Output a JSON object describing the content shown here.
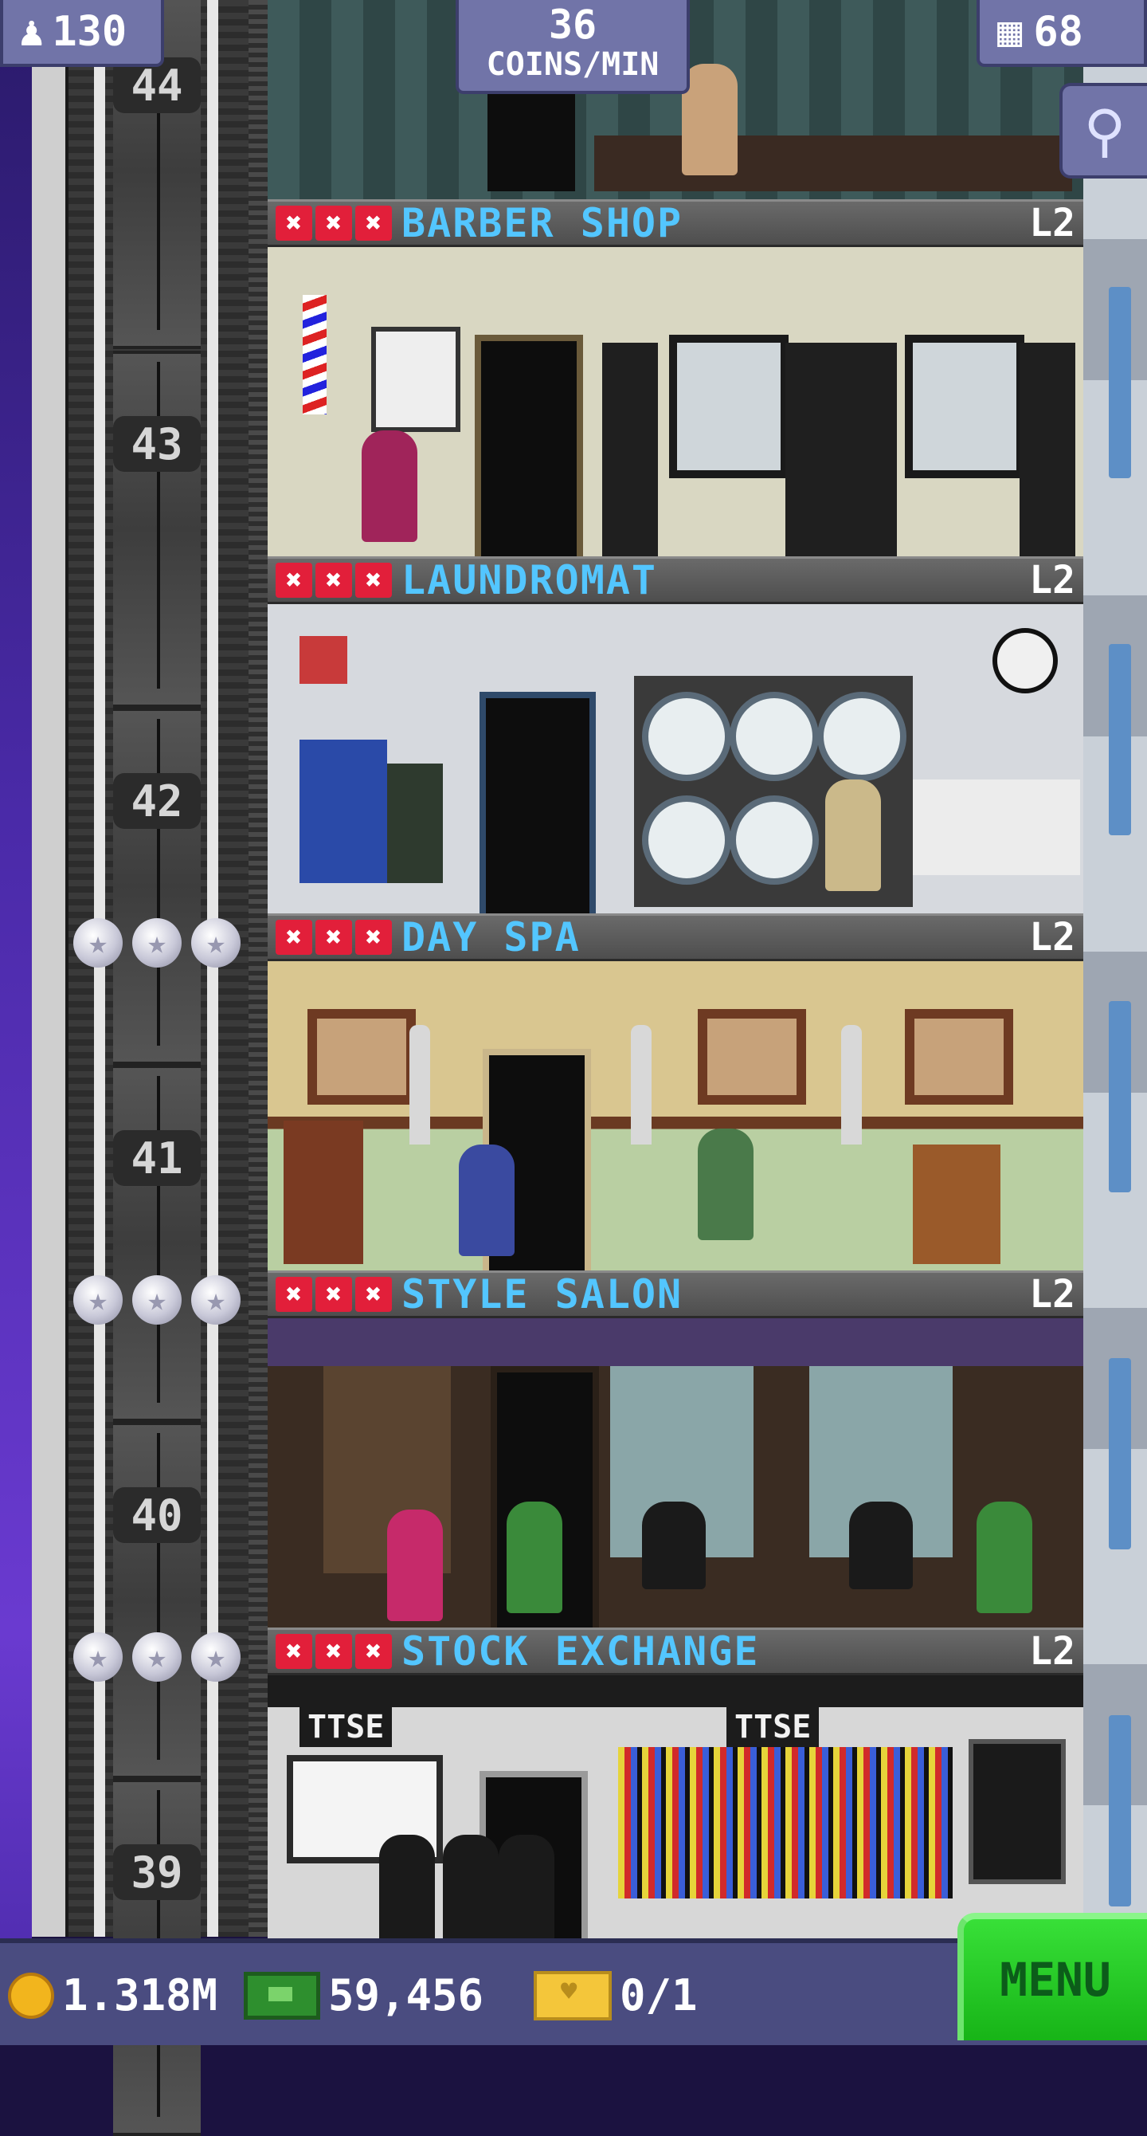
{
  "hud": {
    "population": "130",
    "coins_per_min_value": "36",
    "coins_per_min_unit": "COINS/MIN",
    "floor_count": "68"
  },
  "elevator": {
    "floor_numbers": [
      "44",
      "43",
      "42",
      "41",
      "40",
      "39"
    ]
  },
  "floors": [
    {
      "name": "BARBER SHOP",
      "level": "L2",
      "stocked": 0,
      "max_stock": 3
    },
    {
      "name": "LAUNDROMAT",
      "level": "L2",
      "stocked": 0,
      "max_stock": 3
    },
    {
      "name": "DAY SPA",
      "level": "L2",
      "stocked": 0,
      "max_stock": 3
    },
    {
      "name": "STYLE SALON",
      "level": "L2",
      "stocked": 0,
      "max_stock": 3
    },
    {
      "name": "STOCK EXCHANGE",
      "level": "L2",
      "stocked": 0,
      "max_stock": 3
    }
  ],
  "room_signs": {
    "stock_exchange_sign": "TTSE"
  },
  "bottom": {
    "coins": "1.318M",
    "bux": "59,456",
    "tickets": "0/1",
    "menu_label": "MENU"
  },
  "colors": {
    "room_name": "#53c6ff",
    "stock_marker": "#e21f3a",
    "menu_button": "#1fc41f",
    "hud_panel": "#7174a8"
  },
  "icons": {
    "population": "person-icon",
    "floors": "building-icon",
    "search": "magnifier-icon",
    "coins": "coin-icon",
    "bux": "bux-icon",
    "tickets": "ticket-icon"
  }
}
